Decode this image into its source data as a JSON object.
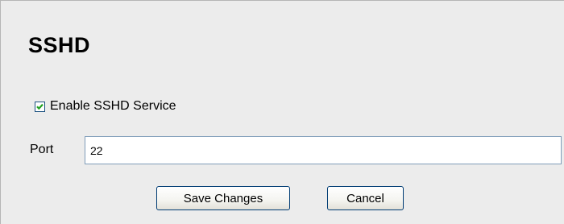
{
  "panel": {
    "title": "SSHD"
  },
  "enable_service": {
    "label": "Enable SSHD Service",
    "checked": true
  },
  "port": {
    "label": "Port",
    "value": "22"
  },
  "buttons": {
    "save_label": "Save Changes",
    "cancel_label": "Cancel"
  },
  "colors": {
    "panel_background": "#ececec",
    "checkbox_check": "#21a121",
    "button_border": "#003c74",
    "input_border": "#7f9db9"
  }
}
